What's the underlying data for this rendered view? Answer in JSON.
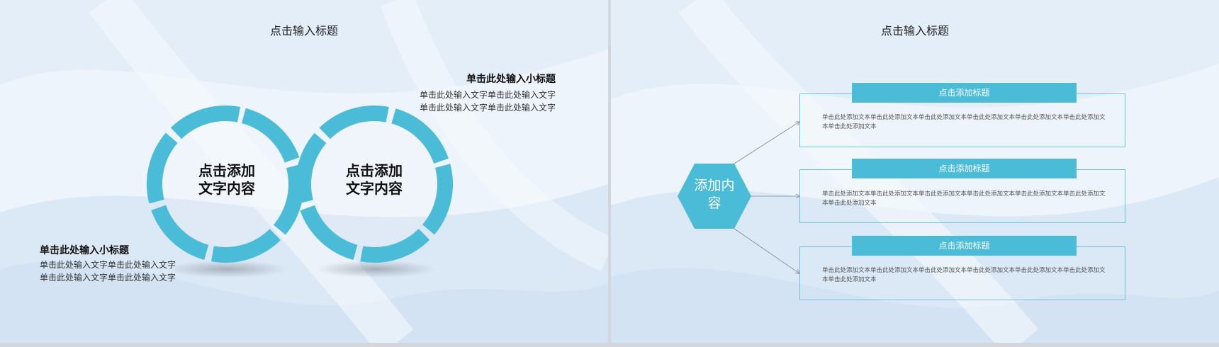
{
  "slide_left": {
    "title": "点击输入标题",
    "ring_left_label": [
      "点击添加",
      "文字内容"
    ],
    "ring_right_label": [
      "点击添加",
      "文字内容"
    ],
    "top_right_block": {
      "subheading": "单击此处输入小标题",
      "lines": [
        "单击此处输入文字单击此处输入文字",
        "单击此处输入文字单击此处输入文字"
      ]
    },
    "bottom_left_block": {
      "subheading": "单击此处输入小标题",
      "lines": [
        "单击此处输入文字单击此处输入文字",
        "单击此处输入文字单击此处输入文字"
      ]
    }
  },
  "slide_right": {
    "title": "点击输入标题",
    "hexagon_label": [
      "添加内",
      "容"
    ],
    "boxes": [
      {
        "title": "点击添加标题",
        "text": [
          "单击此处添加文本单击此处添加文本单击此处添加文本单击此处添加文本单击此处添加文本单击此处添加文",
          "本单击此处添加文本"
        ]
      },
      {
        "title": "点击添加标题",
        "text": [
          "单击此处添加文本单击此处添加文本单击此处添加文本单击此处添加文本单击此处添加文本单击此处添加文",
          "本单击此处添加文本"
        ]
      },
      {
        "title": "点击添加标题",
        "text": [
          "单击此处添加文本单击此处添加文本单击此处添加文本单击此处添加文本单击此处添加文本单击此处添加文",
          "本单击此处添加文本"
        ]
      }
    ]
  },
  "colors": {
    "accent": "#4bbcd8",
    "background": "#eef4fb",
    "box_border": "#6cc6d8"
  }
}
